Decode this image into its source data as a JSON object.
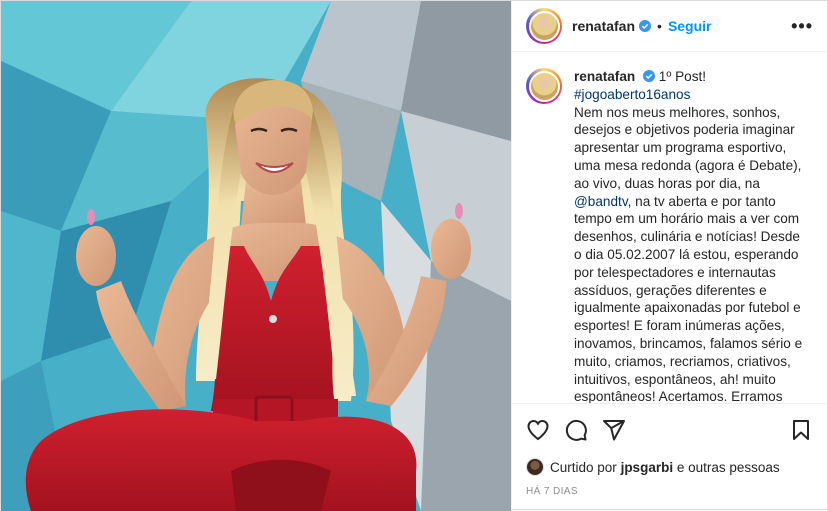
{
  "header": {
    "username": "renatafan",
    "follow_label": "Seguir",
    "dot": "•",
    "more_label": "•••"
  },
  "caption": {
    "username": "renatafan",
    "first_line": "1º Post!",
    "hashtag": "#jogoaberto16anos",
    "body_1": "Nem nos meus melhores, sonhos, desejos e objetivos poderia imaginar apresentar um programa esportivo, uma mesa redonda (agora é Debate), ao vivo, duas horas por dia, na ",
    "mention": "@bandtv",
    "body_2": ", na tv aberta e por tanto tempo em um horário mais a ver com desenhos, culinária e notícias! Desde o dia 05.02.2007 lá estou, esperando por telespectadores e internautas assíduos, gerações diferentes e igualmente apaixonadas por futebol e esportes! E foram inúmeras ações, inovamos, brincamos, falamos sério e muito, criamos, recriamos, criativos, intuitivos, espontâneos, ah! muito espontâneos! Acertamos. Erramos também, faz parte do aprendizado..."
  },
  "actions": {
    "like": "heart-icon",
    "comment": "comment-icon",
    "share": "share-icon",
    "save": "bookmark-icon"
  },
  "likes": {
    "prefix": "Curtido por",
    "user": "jpsgarbi",
    "suffix": "e outras pessoas"
  },
  "timestamp": "HÁ 7 DIAS",
  "colors": {
    "accent": "#0095f6",
    "verified": "#3897f0",
    "dress": "#c01a2a"
  }
}
